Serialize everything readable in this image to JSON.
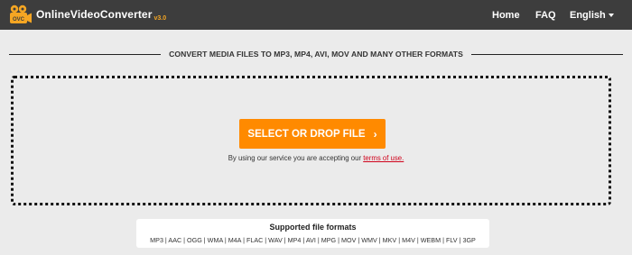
{
  "header": {
    "logo_text": "OnlineVideoConverter",
    "logo_version": "v3.0",
    "logo_badge": "OVC",
    "nav": {
      "home": "Home",
      "faq": "FAQ",
      "language": "English"
    }
  },
  "main": {
    "headline": "CONVERT MEDIA FILES TO MP3, MP4, AVI, MOV AND MANY OTHER FORMATS",
    "select_button": "SELECT OR DROP FILE",
    "terms_prefix": "By using our service you are accepting our ",
    "terms_link": "terms of use."
  },
  "formats": {
    "title": "Supported file formats",
    "list": "MP3 | AAC | OGG | WMA | M4A | FLAC | WAV | MP4 | AVI | MPG | MOV | WMV | MKV | M4V | WEBM | FLV | 3GP"
  },
  "colors": {
    "topbar": "#3d3d3d",
    "accent": "#ff8a00",
    "link": "#d0021b",
    "background": "#ebebeb"
  }
}
